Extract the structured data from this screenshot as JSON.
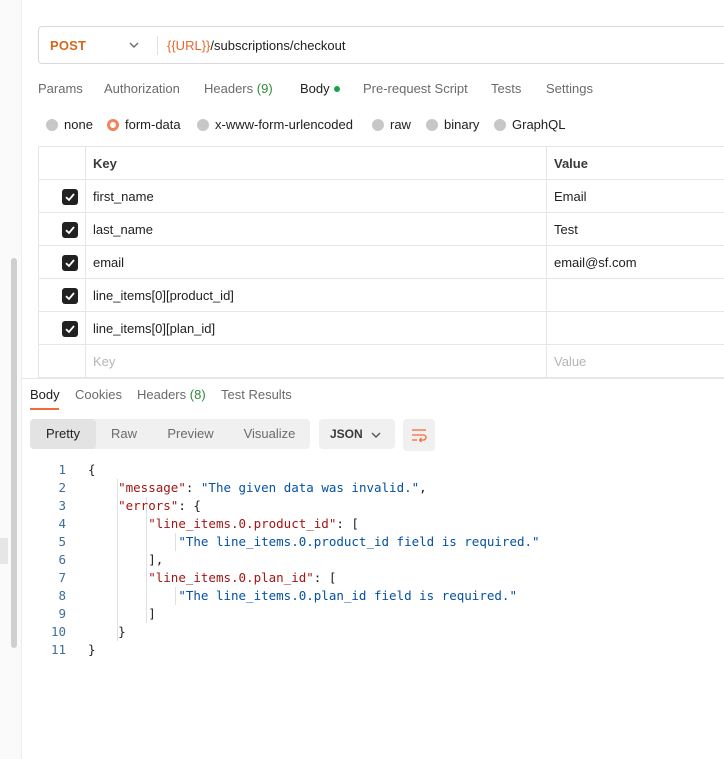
{
  "request": {
    "method": "POST",
    "url_var": "{{URL}}",
    "url_path": "/subscriptions/checkout"
  },
  "request_tabs": [
    {
      "label": "Params"
    },
    {
      "label": "Authorization"
    },
    {
      "label": "Headers",
      "count": "(9)"
    },
    {
      "label": "Body"
    },
    {
      "label": "Pre-request Script"
    },
    {
      "label": "Tests"
    },
    {
      "label": "Settings"
    }
  ],
  "body_types": [
    {
      "label": "none",
      "selected": false
    },
    {
      "label": "form-data",
      "selected": true
    },
    {
      "label": "x-www-form-urlencoded",
      "selected": false
    },
    {
      "label": "raw",
      "selected": false
    },
    {
      "label": "binary",
      "selected": false
    },
    {
      "label": "GraphQL",
      "selected": false
    }
  ],
  "params_table": {
    "headers": {
      "key": "Key",
      "value": "Value"
    },
    "rows": [
      {
        "key": "first_name",
        "value": "Email",
        "checked": true
      },
      {
        "key": "last_name",
        "value": "Test",
        "checked": true
      },
      {
        "key": "email",
        "value": "email@sf.com",
        "checked": true
      },
      {
        "key": "line_items[0][product_id]",
        "value": "",
        "checked": true
      },
      {
        "key": "line_items[0][plan_id]",
        "value": "",
        "checked": true
      }
    ],
    "placeholder": {
      "key": "Key",
      "value": "Value"
    }
  },
  "response_tabs": [
    {
      "label": "Body"
    },
    {
      "label": "Cookies"
    },
    {
      "label": "Headers",
      "count": "(8)"
    },
    {
      "label": "Test Results"
    }
  ],
  "view_modes": [
    "Pretty",
    "Raw",
    "Preview",
    "Visualize"
  ],
  "format": "JSON",
  "code": {
    "line_numbers": [
      "1",
      "2",
      "3",
      "4",
      "5",
      "6",
      "7",
      "8",
      "9",
      "10",
      "11"
    ],
    "lines": [
      [
        {
          "t": "{",
          "c": "p"
        }
      ],
      [
        {
          "t": "    ",
          "c": "p"
        },
        {
          "t": "\"message\"",
          "c": "k"
        },
        {
          "t": ": ",
          "c": "p"
        },
        {
          "t": "\"The given data was invalid.\"",
          "c": "s"
        },
        {
          "t": ",",
          "c": "p"
        }
      ],
      [
        {
          "t": "    ",
          "c": "p"
        },
        {
          "t": "\"errors\"",
          "c": "k"
        },
        {
          "t": ": {",
          "c": "p"
        }
      ],
      [
        {
          "t": "        ",
          "c": "p"
        },
        {
          "t": "\"line_items.0.product_id\"",
          "c": "k"
        },
        {
          "t": ": [",
          "c": "p"
        }
      ],
      [
        {
          "t": "            ",
          "c": "p"
        },
        {
          "t": "\"The line_items.0.product_id field is required.\"",
          "c": "s"
        }
      ],
      [
        {
          "t": "        ],",
          "c": "p"
        }
      ],
      [
        {
          "t": "        ",
          "c": "p"
        },
        {
          "t": "\"line_items.0.plan_id\"",
          "c": "k"
        },
        {
          "t": ": [",
          "c": "p"
        }
      ],
      [
        {
          "t": "            ",
          "c": "p"
        },
        {
          "t": "\"The line_items.0.plan_id field is required.\"",
          "c": "s"
        }
      ],
      [
        {
          "t": "        ]",
          "c": "p"
        }
      ],
      [
        {
          "t": "    }",
          "c": "p"
        }
      ],
      [
        {
          "t": "}",
          "c": "p"
        }
      ]
    ]
  },
  "colors": {
    "accent": "#f26b3a",
    "method": "#d2691e",
    "count_green": "#2f8a3b",
    "json_key": "#a31515",
    "json_string": "#0451a5"
  },
  "icons": {
    "method_dropdown": "chevron-down-icon",
    "format_dropdown": "chevron-down-icon",
    "wrap": "wrap-lines-icon",
    "check": "check-icon"
  }
}
